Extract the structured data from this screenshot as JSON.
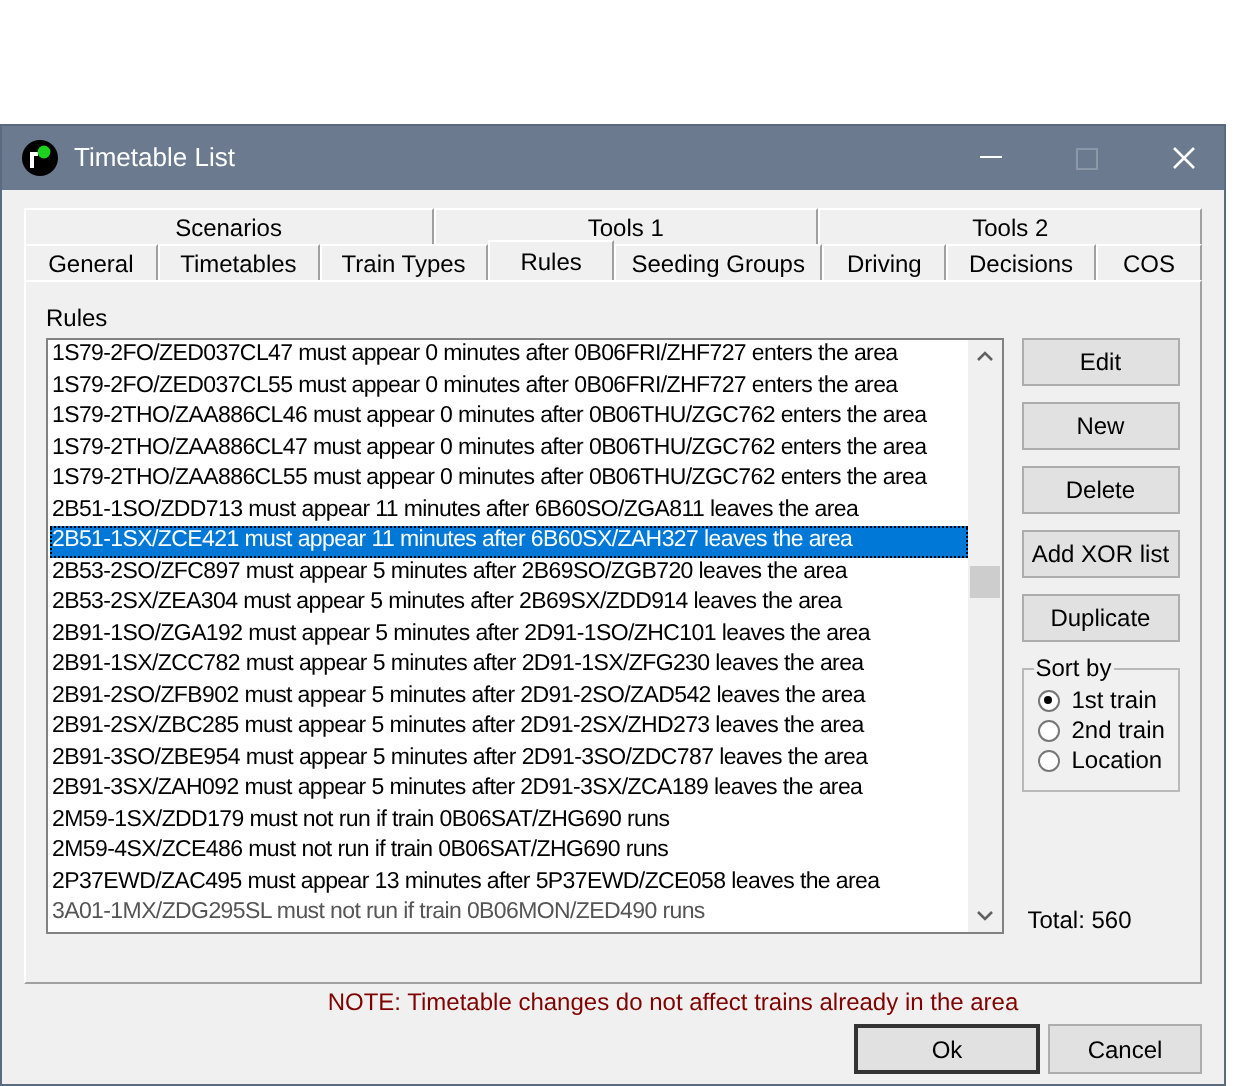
{
  "window": {
    "title": "Timetable List"
  },
  "tabs_row_1": [
    {
      "label": "Scenarios",
      "selected": false
    },
    {
      "label": "Tools 1",
      "selected": false
    },
    {
      "label": "Tools 2",
      "selected": false
    }
  ],
  "tabs_row_2": [
    {
      "label": "General",
      "selected": false
    },
    {
      "label": "Timetables",
      "selected": false
    },
    {
      "label": "Train Types",
      "selected": false
    },
    {
      "label": "Rules",
      "selected": true
    },
    {
      "label": "Seeding Groups",
      "selected": false
    },
    {
      "label": "Driving",
      "selected": false
    },
    {
      "label": "Decisions",
      "selected": false
    },
    {
      "label": "COS",
      "selected": false
    }
  ],
  "rules_label": "Rules",
  "rules": [
    {
      "text": "1S79-2FO/ZED037CL47 must appear 0 minutes after 0B06FRI/ZHF727 enters the area",
      "selected": false
    },
    {
      "text": "1S79-2FO/ZED037CL55 must appear 0 minutes after 0B06FRI/ZHF727 enters the area",
      "selected": false
    },
    {
      "text": "1S79-2THO/ZAA886CL46 must appear 0 minutes after 0B06THU/ZGC762 enters the area",
      "selected": false
    },
    {
      "text": "1S79-2THO/ZAA886CL47 must appear 0 minutes after 0B06THU/ZGC762 enters the area",
      "selected": false
    },
    {
      "text": "1S79-2THO/ZAA886CL55 must appear 0 minutes after 0B06THU/ZGC762 enters the area",
      "selected": false
    },
    {
      "text": "2B51-1SO/ZDD713 must appear 11 minutes after 6B60SO/ZGA811 leaves the area",
      "selected": false
    },
    {
      "text": "2B51-1SX/ZCE421 must appear 11 minutes after 6B60SX/ZAH327 leaves the area",
      "selected": true
    },
    {
      "text": "2B53-2SO/ZFC897 must appear 5 minutes after 2B69SO/ZGB720 leaves the area",
      "selected": false
    },
    {
      "text": "2B53-2SX/ZEA304 must appear 5 minutes after 2B69SX/ZDD914 leaves the area",
      "selected": false
    },
    {
      "text": "2B91-1SO/ZGA192 must appear 5 minutes after 2D91-1SO/ZHC101 leaves the area",
      "selected": false
    },
    {
      "text": "2B91-1SX/ZCC782 must appear 5 minutes after 2D91-1SX/ZFG230 leaves the area",
      "selected": false
    },
    {
      "text": "2B91-2SO/ZFB902 must appear 5 minutes after 2D91-2SO/ZAD542 leaves the area",
      "selected": false
    },
    {
      "text": "2B91-2SX/ZBC285 must appear 5 minutes after 2D91-2SX/ZHD273 leaves the area",
      "selected": false
    },
    {
      "text": "2B91-3SO/ZBE954 must appear 5 minutes after 2D91-3SO/ZDC787 leaves the area",
      "selected": false
    },
    {
      "text": "2B91-3SX/ZAH092 must appear 5 minutes after 2D91-3SX/ZCA189 leaves the area",
      "selected": false
    },
    {
      "text": "2M59-1SX/ZDD179 must not run if train 0B06SAT/ZHG690 runs",
      "selected": false
    },
    {
      "text": "2M59-4SX/ZCE486 must not run if train 0B06SAT/ZHG690 runs",
      "selected": false
    },
    {
      "text": "2P37EWD/ZAC495 must appear 13 minutes after 5P37EWD/ZCE058 leaves the area",
      "selected": false
    },
    {
      "text": "3A01-1MX/ZDG295SL must not run if train 0B06MON/ZED490 runs",
      "selected": false
    }
  ],
  "buttons": [
    "Edit",
    "New",
    "Delete",
    "Add XOR list",
    "Duplicate"
  ],
  "sort_by": {
    "label": "Sort by",
    "options": [
      {
        "label": "1st train",
        "selected": true
      },
      {
        "label": "2nd train",
        "selected": false
      },
      {
        "label": "Location",
        "selected": false
      }
    ]
  },
  "total": "Total: 560",
  "note": "NOTE: Timetable changes do not affect trains already in the area",
  "dialog_buttons": [
    "Ok",
    "Cancel"
  ]
}
